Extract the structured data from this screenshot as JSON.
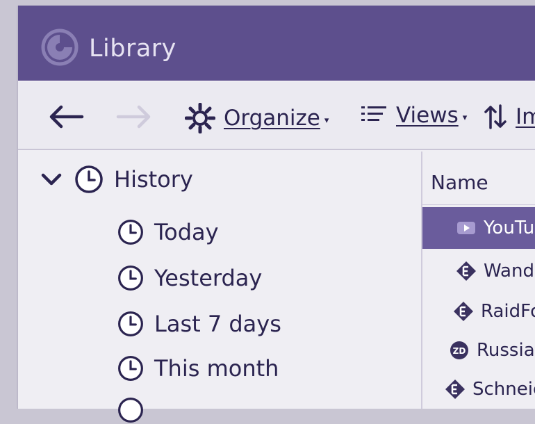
{
  "window": {
    "title": "Library",
    "app_icon": "firefox-logo-icon"
  },
  "toolbar": {
    "back_icon": "arrow-left-icon",
    "forward_icon": "arrow-right-icon",
    "organize_label": "Organize",
    "views_label": "Views",
    "import_label": "Im"
  },
  "tree": {
    "root": {
      "label": "History",
      "icon": "clock-icon",
      "expanded": true
    },
    "children": [
      {
        "label": "Today"
      },
      {
        "label": "Yesterday"
      },
      {
        "label": "Last 7 days"
      },
      {
        "label": "This month"
      }
    ]
  },
  "list": {
    "column_header": "Name",
    "rows": [
      {
        "text": "YouTu",
        "icon": "youtube-play-icon",
        "selected": true
      },
      {
        "text": "Wande",
        "icon": "site-favicon-icon",
        "selected": false
      },
      {
        "text": "RaidFor",
        "icon": "site-favicon-icon",
        "selected": false
      },
      {
        "text": "Russian",
        "icon": "zdnet-favicon-icon",
        "selected": false
      },
      {
        "text": "Schneier",
        "icon": "site-favicon-icon",
        "selected": false
      }
    ]
  },
  "colors": {
    "titlebar": "#5d4f8d",
    "accent": "#6a5c9c",
    "text": "#2b2450",
    "background": "#efeef3"
  }
}
